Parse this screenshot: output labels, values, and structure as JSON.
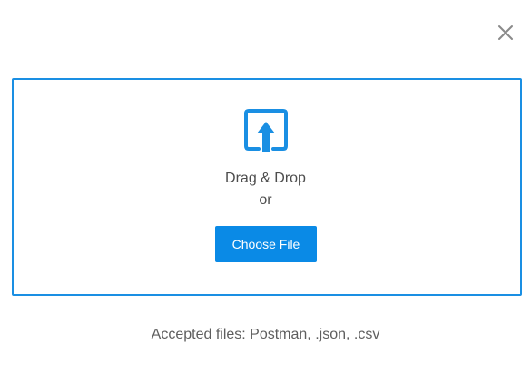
{
  "dialog": {
    "close_icon": "close-icon",
    "upload_icon": "upload-icon",
    "drag_text": "Drag & Drop",
    "or_text": "or",
    "choose_button_label": "Choose File",
    "accepted_text": "Accepted files: Postman, .json, .csv"
  },
  "colors": {
    "accent": "#1a8fe3",
    "button_bg": "#0a8ae6",
    "text": "#4d4d4d",
    "muted_text": "#5e5e5e",
    "close_icon": "#8a8a8a"
  }
}
